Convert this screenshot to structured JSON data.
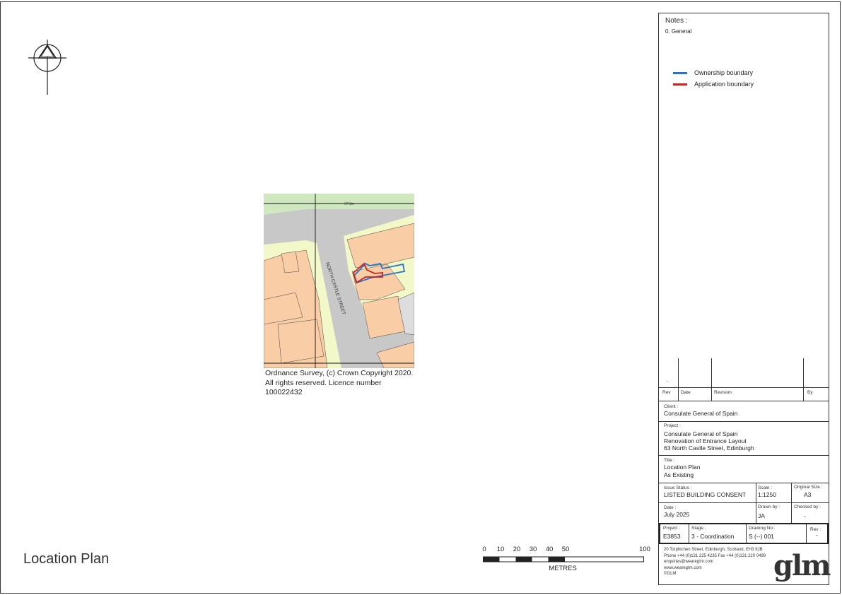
{
  "drawing_title": "Location Plan",
  "map": {
    "copyright_text": "Ordnance Survey, (c) Crown Copyright 2020. All rights reserved. Licence number 100022432",
    "street_label": "NORTH CASTLE STREET",
    "spot_height": "57.3m",
    "colors": {
      "building": "#f9cea6",
      "road": "#c8c8c8",
      "garden": "#f3f8c8",
      "park": "#cfe8c0",
      "ownership": "#2a74c6",
      "application": "#d21e1e"
    }
  },
  "scale_bar": {
    "ticks": [
      "0",
      "10",
      "20",
      "30",
      "40",
      "50",
      "100"
    ],
    "unit": "METRES"
  },
  "notes": {
    "title": "Notes :",
    "items": [
      "0. General"
    ]
  },
  "legend": [
    {
      "label": "Ownership boundary",
      "color": "#2a74c6"
    },
    {
      "label": "Application boundary",
      "color": "#d21e1e"
    }
  ],
  "revision_table": {
    "headers": [
      "Rev",
      "Date",
      "Revision",
      "By"
    ],
    "first_row_rev": "-"
  },
  "client": {
    "label": "Client :",
    "value": "Consulate General of Spain"
  },
  "project_info": {
    "label": "Project :",
    "lines": [
      "Consulate General of Spain",
      "Renovation of Entrance Layout",
      "63 North Castle Street, Edinburgh"
    ]
  },
  "title_block": {
    "label": "Title :",
    "lines": [
      "Location Plan",
      "As Existing"
    ]
  },
  "issue_status": {
    "label": "Issue Status :",
    "value": "LISTED BUILDING CONSENT"
  },
  "scale": {
    "label": "Scale :",
    "value": "1:1250"
  },
  "original_size": {
    "label": "Original Size :",
    "value": "A3"
  },
  "date": {
    "label": "Date :",
    "value": "July 2025"
  },
  "drawn_by": {
    "label": "Drawn by :",
    "value": "JA"
  },
  "checked_by": {
    "label": "Checked by :",
    "value": "-"
  },
  "project_no": {
    "label": "Project :",
    "value": "E3853"
  },
  "stage": {
    "label": "Stage :",
    "value": "3 - Coordination"
  },
  "drawing_no": {
    "label": "Drawing No :",
    "value": "S (--) 001"
  },
  "rev": {
    "label": "Rev :",
    "value": "-"
  },
  "company": {
    "logo": "glm",
    "address_lines": [
      "20 Torphichen Street, Edinburgh, Scotland, EH3 8JB",
      "Phone +44 (0)131 225 4235   Fax +44 (0)131 220 0499",
      "enquiries@wearegIm.com",
      "www.wearegIm.com",
      "©GLM"
    ]
  }
}
